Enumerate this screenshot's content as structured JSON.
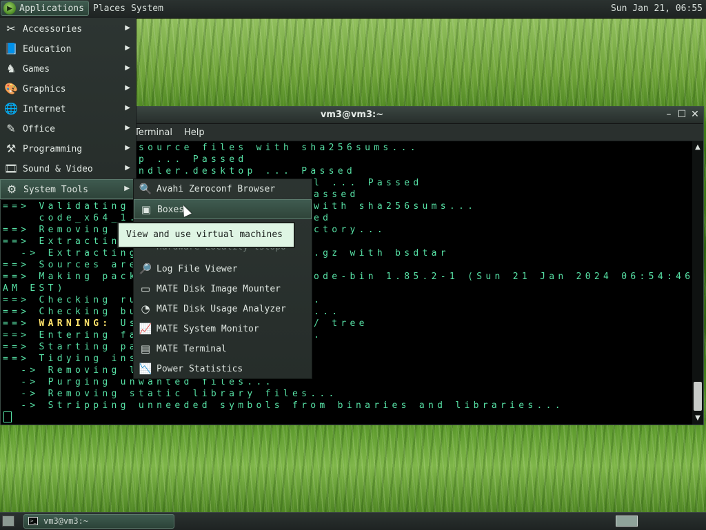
{
  "top_panel": {
    "applications": "Applications",
    "places": "Places",
    "system": "System",
    "clock": "Sun Jan 21, 06:55"
  },
  "apps_menu": {
    "items": [
      {
        "label": "Accessories",
        "icon": "accessories-icon"
      },
      {
        "label": "Education",
        "icon": "education-icon"
      },
      {
        "label": "Games",
        "icon": "games-icon"
      },
      {
        "label": "Graphics",
        "icon": "graphics-icon"
      },
      {
        "label": "Internet",
        "icon": "internet-icon"
      },
      {
        "label": "Office",
        "icon": "office-icon"
      },
      {
        "label": "Programming",
        "icon": "programming-icon"
      },
      {
        "label": "Sound & Video",
        "icon": "sound-video-icon"
      },
      {
        "label": "System Tools",
        "icon": "system-tools-icon"
      }
    ]
  },
  "submenu": {
    "items": [
      {
        "label": "Avahi Zeroconf Browser",
        "icon": "avahi-icon"
      },
      {
        "label": "Boxes",
        "icon": "boxes-icon"
      },
      {
        "label": "Hardware Locality lstopo",
        "icon": "hwloc-icon"
      },
      {
        "label": "Log File Viewer",
        "icon": "log-viewer-icon"
      },
      {
        "label": "MATE Disk Image Mounter",
        "icon": "disk-mounter-icon"
      },
      {
        "label": "MATE Disk Usage Analyzer",
        "icon": "disk-usage-icon"
      },
      {
        "label": "MATE System Monitor",
        "icon": "system-monitor-icon"
      },
      {
        "label": "MATE Terminal",
        "icon": "terminal-icon"
      },
      {
        "label": "Power Statistics",
        "icon": "power-statistics-icon"
      }
    ]
  },
  "tooltip": "View and use virtual machines",
  "terminal": {
    "title": "vm3@vm3:~",
    "menu": [
      "Terminal",
      "Help"
    ],
    "lines": [
      "source files with sha256sums...",
      "p ... Passed",
      "ndler.desktop ... Passed",
      "l ... Passed",
      "assed",
      "with sha256sums...",
      "ed",
      "ctory...",
      ".gz with bsdtar",
      "ode-bin 1.85.2-1 (Sun 21 Jan 2024 06:54:46",
      "AM EST)",
      ".",
      "...",
      "/ tree",
      ".",
      "==> Validating",
      "    code_x64_1.",
      "==> Removing",
      "==> Extracting",
      "  -> Extracting",
      "==> Sources are",
      "==> Making pack",
      "==> Checking ru",
      "==> Checking bu",
      "WARNING:",
      "Us",
      "==> Entering fa",
      "==> Starting pa",
      "==> Tidying ins",
      "  -> Removing l",
      "  -> Purging unwanted files...",
      "  -> Removing static library files...",
      "  -> Stripping unneeded symbols from binaries and libraries..."
    ]
  },
  "taskbar": {
    "task_label": "vm3@vm3:~"
  }
}
